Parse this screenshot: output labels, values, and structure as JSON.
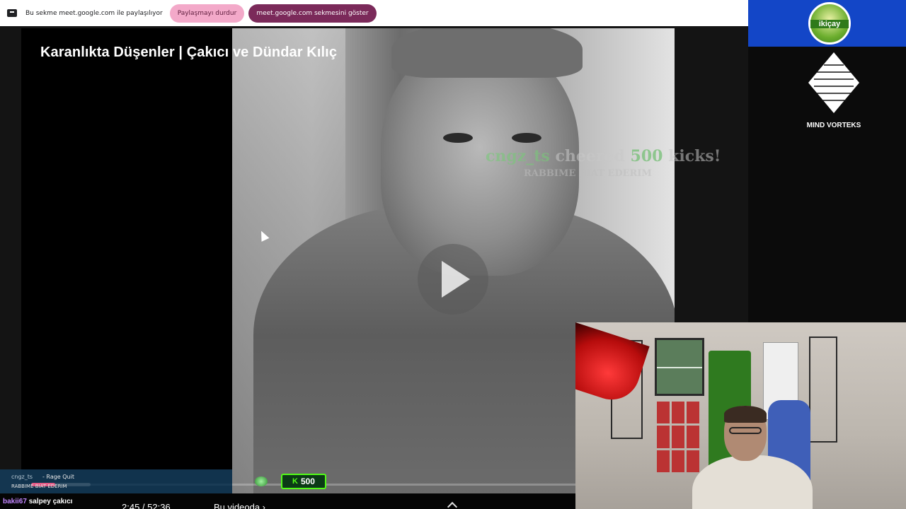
{
  "share_bar": {
    "text": "Bu sekme meet.google.com ile paylaşılıyor",
    "stop_label": "Paylaşmayı durdur",
    "show_label": "meet.google.com sekmesini göster"
  },
  "video": {
    "title": "Karanlıkta Düşenler | Çakıcı ve Dündar Kılıç",
    "time": "2:45 / 52:36",
    "chapter_label": "Bu videoda ›"
  },
  "kick_alert": {
    "username": "cngz_ts",
    "action": " cheered ",
    "amount": "500",
    "suffix": " kicks!",
    "message": "RABBIME BIAT EDERIM"
  },
  "brand": {
    "logo_text": "ikiçay",
    "vorteks_label": "MIND VORTEKS"
  },
  "chat": {
    "top_user": "cngz_ts",
    "top_label": "- Rage Quit",
    "top_message": "RABBIME BIAT EDERIM",
    "kick_amount": "500",
    "progress_fraction": 0.4,
    "line2_name": "bakii67",
    "line2_text": " salpey çakıcı"
  },
  "colors": {
    "kick_green": "#53fc18",
    "share_stop_bg": "#f3a9c9",
    "share_show_bg": "#7b2a5a",
    "brand_blue": "#1346c7"
  }
}
